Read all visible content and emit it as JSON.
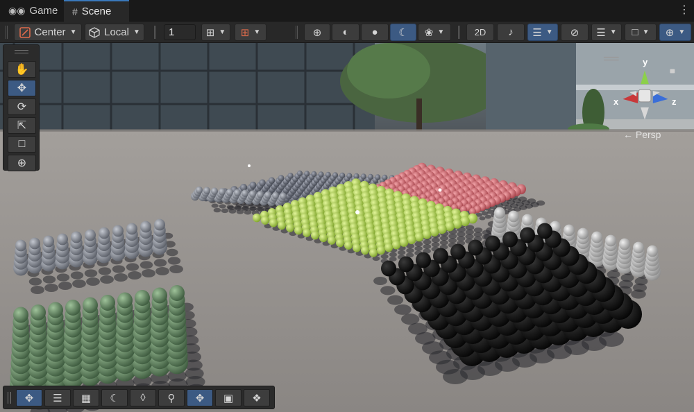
{
  "tabs": [
    {
      "label": "Game",
      "icon": "gamepad-icon"
    },
    {
      "label": "Scene",
      "icon": "hash-icon"
    }
  ],
  "toolbar": {
    "pivot_mode": "Center",
    "pivot_rotation": "Local",
    "grid_increment_value": "1"
  },
  "gizmo": {
    "x_label": "x",
    "y_label": "y",
    "z_label": "z",
    "projection": "Persp"
  },
  "colors": {
    "accent": "#3c5a83",
    "toolbar_bg": "#282828",
    "button_bg": "#3c3c3c",
    "gizmo_x": "#c8383a",
    "gizmo_y": "#8cd04a",
    "gizmo_z": "#3a6ed8"
  }
}
